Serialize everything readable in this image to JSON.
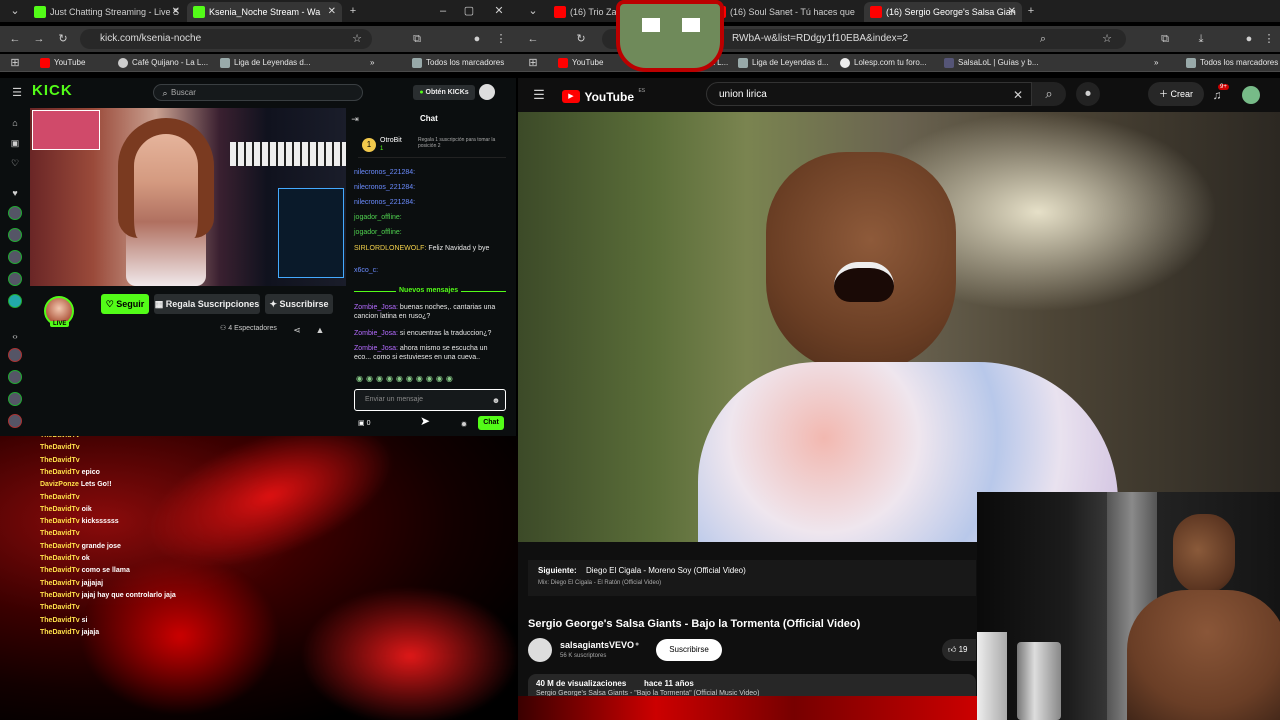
{
  "left_browser": {
    "tabs": [
      {
        "title": "Just Chatting Streaming - Live S"
      },
      {
        "title": "Ksenia_Noche Stream - Wa"
      }
    ],
    "url": "kick.com/ksenia-noche",
    "bookmarks": [
      "YouTube",
      "Café Quijano - La L...",
      "Liga de Leyendas d...",
      "»",
      "Todos los marcadores"
    ]
  },
  "kick": {
    "logo": "KICK",
    "search_placeholder": "Buscar",
    "obtain_kicks": "Obtén KICKs",
    "chat_title": "Chat",
    "gift_user": "OtroBit",
    "gift_count": "1",
    "gift_text": "Regala 1 suscripción para tomar la posición 2",
    "follow_label": "Seguir",
    "gift_subs_label": "Regala Suscripciones",
    "subscribe_label": "Suscribirse",
    "viewers": "4 Espectadores",
    "live_badge": "LIVE",
    "new_messages": "Nuevos mensajes",
    "chat_messages": [
      {
        "user": "nilecronos_221284:",
        "text": "",
        "cls": "u-b"
      },
      {
        "user": "nilecronos_221284:",
        "text": "",
        "cls": "u-b"
      },
      {
        "user": "nilecronos_221284:",
        "text": "",
        "cls": "u-b"
      },
      {
        "user": "jogador_offline:",
        "text": "",
        "cls": "u-g"
      },
      {
        "user": "jogador_offline:",
        "text": "",
        "cls": "u-g"
      },
      {
        "user": "SIRLORDLONEWOLF:",
        "text": "Feliz Navidad y bye",
        "cls": "u-y"
      },
      {
        "user": "x6co_c:",
        "text": "",
        "cls": "u-b"
      }
    ],
    "new_chat_messages": [
      {
        "user": "Zombie_Josa:",
        "text": "buenas noches,. cantarias una cancion latina en ruso¿?"
      },
      {
        "user": "Zombie_Josa:",
        "text": "si encuentras la traduccion¿?"
      },
      {
        "user": "Zombie_Josa:",
        "text": "ahora mismo se escucha un eco... como si estuvieses en una cueva.."
      }
    ],
    "message_placeholder": "Enviar un mensaje",
    "kicks_count": "0",
    "chat_button": "Chat"
  },
  "overlay_chat": [
    {
      "user": "TheDavidTv",
      "text": ""
    },
    {
      "user": "TheDavidTv",
      "text": ""
    },
    {
      "user": "TheDavidTv",
      "text": ""
    },
    {
      "user": "TheDavidTv",
      "text": "epico"
    },
    {
      "user": "DavizPonze",
      "text": "Lets Go!!"
    },
    {
      "user": "TheDavidTv",
      "text": ""
    },
    {
      "user": "TheDavidTv",
      "text": "oik"
    },
    {
      "user": "TheDavidTv",
      "text": "kickssssss"
    },
    {
      "user": "TheDavidTv",
      "text": ""
    },
    {
      "user": "TheDavidTv",
      "text": "grande jose"
    },
    {
      "user": "TheDavidTv",
      "text": "ok"
    },
    {
      "user": "TheDavidTv",
      "text": "como se llama"
    },
    {
      "user": "TheDavidTv",
      "text": "jajjajaj"
    },
    {
      "user": "TheDavidTv",
      "text": "jajaj hay que controlarlo jaja"
    },
    {
      "user": "TheDavidTv",
      "text": ""
    },
    {
      "user": "TheDavidTv",
      "text": "si"
    },
    {
      "user": "TheDavidTv",
      "text": "jajaja"
    }
  ],
  "right_browser": {
    "tabs": [
      {
        "title": "(16) Trio Zapa"
      },
      {
        "title": "(16) Soul Sanet - Tú haces que"
      },
      {
        "title": "(16) Sergio George's Salsa Gian"
      }
    ],
    "url": "RWbA-w&list=RDdgy1f10EBA&index=2",
    "bookmarks": [
      "YouTube",
      "La L...",
      "Liga de Leyendas d...",
      "Lolesp.com tu foro...",
      "SalsaLoL | Guías y b...",
      "»",
      "Todos los marcadores"
    ]
  },
  "youtube": {
    "logo": "YouTube",
    "country": "ES",
    "search_value": "union lirica",
    "create_label": "Crear",
    "notif_count": "9+",
    "next_label": "Siguiente:",
    "next_title": "Diego El Cigala - Moreno Soy (Official Video)",
    "mix_label": "Mix: Diego El Cigala - El Ratón (Official Video)",
    "video_title": "Sergio George's Salsa Giants - Bajo la Tormenta (Official Video)",
    "channel_name": "salsagiantsVEVO",
    "subscribers": "56 K suscriptores",
    "subscribe_label": "Suscribirse",
    "likes": "19",
    "views": "40 M de visualizaciones",
    "age": "hace 11 años",
    "description": "Sergio George's Salsa Giants - \"Bajo la Tormenta\" (Official Music Video)"
  }
}
